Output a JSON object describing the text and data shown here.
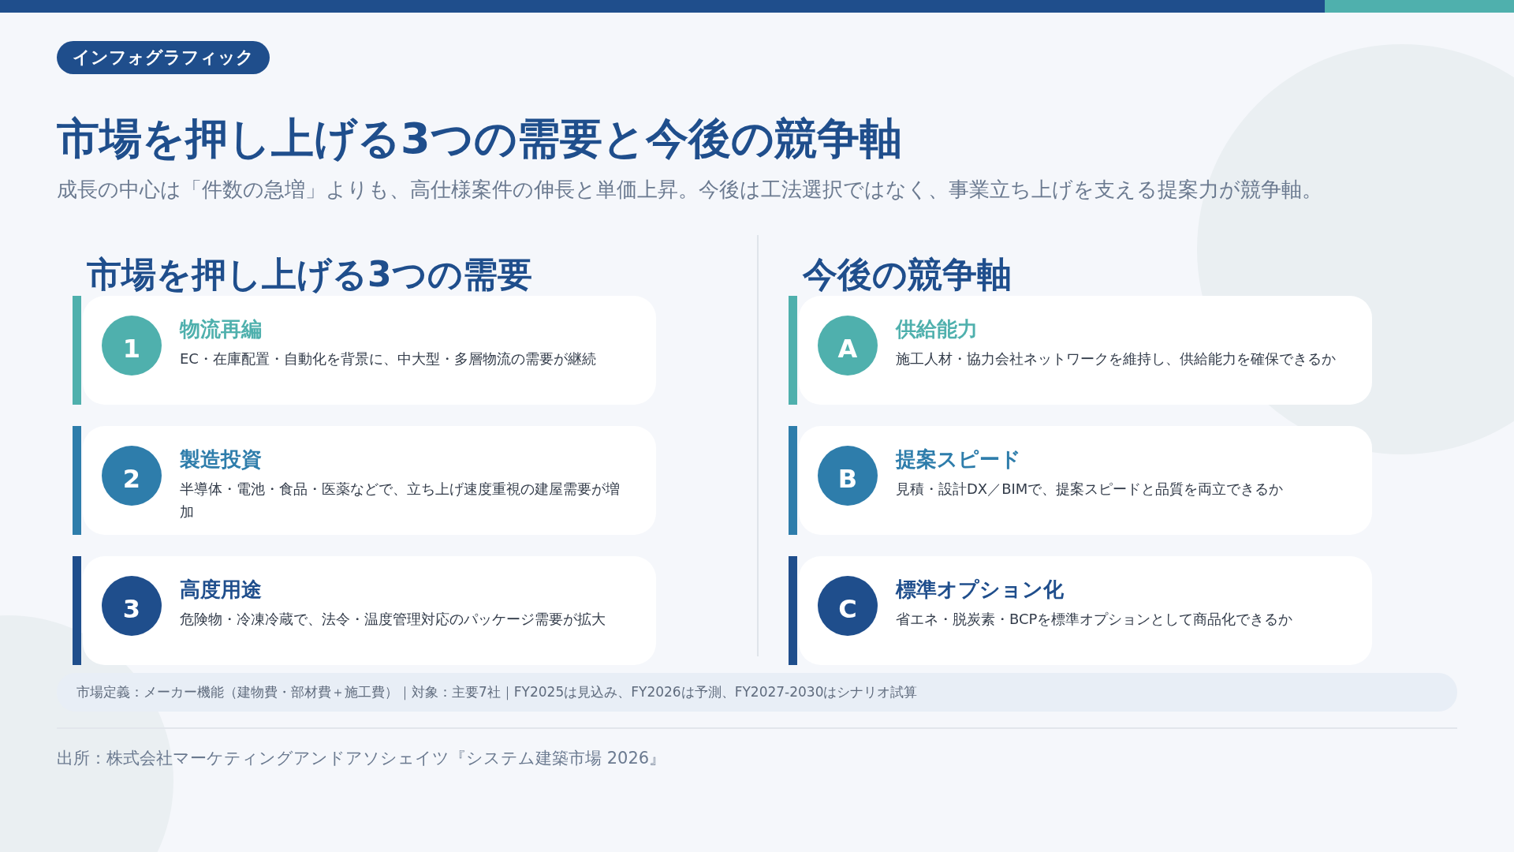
{
  "badge": "インフォグラフィック",
  "title": "市場を押し上げる3つの需要と今後の競争軸",
  "subtitle": "成長の中心は「件数の急増」よりも、高仕様案件の伸長と単価上昇。今後は工法選択ではなく、事業立ち上げを支える提案力が競争軸。",
  "columns": [
    {
      "heading": "市場を押し上げる3つの需要",
      "items": [
        {
          "marker": "1",
          "title": "物流再編",
          "description": "EC・在庫配置・自動化を背景に、中大型・多層物流の需要が継続",
          "color": "#4fb0ad"
        },
        {
          "marker": "2",
          "title": "製造投資",
          "description": "半導体・電池・食品・医薬などで、立ち上げ速度重視の建屋需要が増加",
          "color": "#2e7dab"
        },
        {
          "marker": "3",
          "title": "高度用途",
          "description": "危険物・冷凍冷蔵で、法令・温度管理対応のパッケージ需要が拡大",
          "color": "#1f4e8c"
        }
      ]
    },
    {
      "heading": "今後の競争軸",
      "items": [
        {
          "marker": "A",
          "title": "供給能力",
          "description": "施工人材・協力会社ネットワークを維持し、供給能力を確保できるか",
          "color": "#4fb0ad"
        },
        {
          "marker": "B",
          "title": "提案スピード",
          "description": "見積・設計DX／BIMで、提案スピードと品質を両立できるか",
          "color": "#2e7dab"
        },
        {
          "marker": "C",
          "title": "標準オプション化",
          "description": "省エネ・脱炭素・BCPを標準オプションとして商品化できるか",
          "color": "#1f4e8c"
        }
      ]
    }
  ],
  "note": "市場定義：メーカー機能（建物費・部材費＋施工費）｜対象：主要7社｜FY2025は見込み、FY2026は予測、FY2027-2030はシナリオ試算",
  "source": "出所：株式会社マーケティングアンドアソシェイツ『システム建築市場 2026』"
}
